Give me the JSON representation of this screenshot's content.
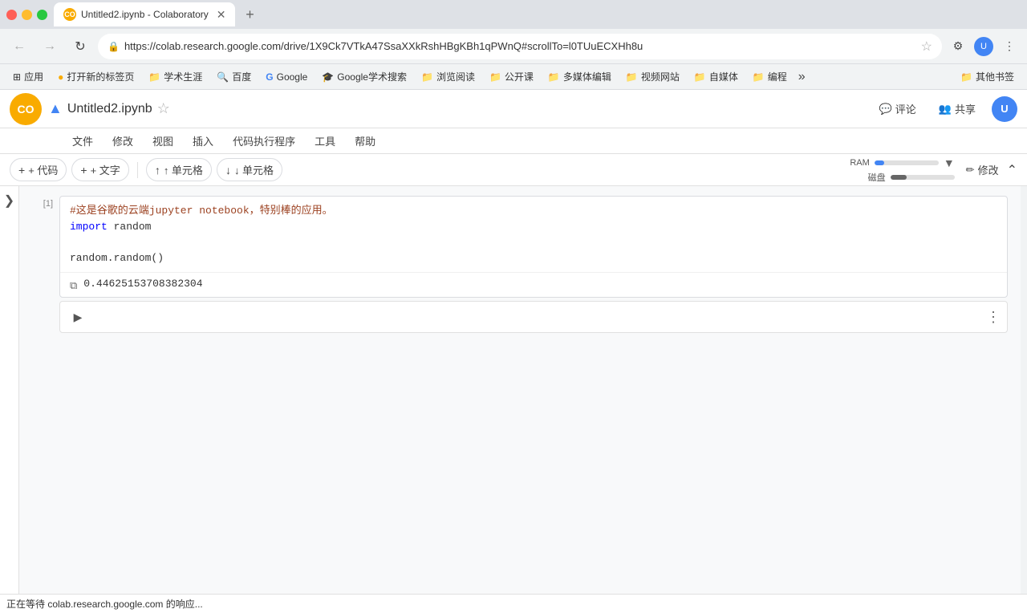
{
  "browser": {
    "tab": {
      "title": "Untitled2.ipynb - Colaboratory",
      "favicon_text": "CO"
    },
    "new_tab_label": "+",
    "nav": {
      "back_title": "后退",
      "forward_title": "前进",
      "refresh_title": "刷新",
      "url": "https://colab.research.google.com/drive/1X9Ck7VTkA47SsaXXkRshHBgKBh1qPWnQ#scrollTo=l0TUuECXHh8u",
      "lock_icon": "🔒",
      "star_icon": "☆"
    },
    "bookmarks": [
      {
        "icon": "⊞",
        "label": "应用"
      },
      {
        "icon": "🔶",
        "label": "打开新的标签页"
      },
      {
        "icon": "📁",
        "label": "学术生涯"
      },
      {
        "icon": "🔍",
        "label": "百度"
      },
      {
        "icon": "G",
        "label": "Google"
      },
      {
        "icon": "🎓",
        "label": "Google学术搜索"
      },
      {
        "icon": "📁",
        "label": "浏览阅读"
      },
      {
        "icon": "📁",
        "label": "公开课"
      },
      {
        "icon": "📁",
        "label": "多媒体编辑"
      },
      {
        "icon": "📁",
        "label": "视频网站"
      },
      {
        "icon": "📁",
        "label": "自媒体"
      },
      {
        "icon": "📁",
        "label": "编程"
      }
    ],
    "bookmarks_more": "»",
    "other_bookmarks": "其他书签"
  },
  "colab": {
    "logo_text": "CO",
    "drive_icon": "▲",
    "file_name": "Untitled2.ipynb",
    "star_icon": "☆",
    "menu_items": [
      "文件",
      "修改",
      "视图",
      "插入",
      "代码执行程序",
      "工具",
      "帮助"
    ],
    "toolbar": {
      "add_code": "+ 代码",
      "add_text": "+ 文字",
      "move_up": "↑ 单元格",
      "move_down": "↓ 单元格"
    },
    "ram_label": "RAM",
    "disk_label": "磁盘",
    "ram_percent": 15,
    "disk_percent": 25,
    "edit_label": "修改",
    "comment_label": "评论",
    "share_label": "共享",
    "left_toggle_icon": "❯",
    "cell": {
      "number": "[1]",
      "code_line1": "#这是谷歌的云端jupyter notebook，特别棒的应用。",
      "code_line2": "import random",
      "code_line3": "",
      "code_line4": "random.random()",
      "output_value": "0.44625153708382304"
    },
    "empty_cell_run_icon": "▶",
    "empty_cell_menu_icon": "⋮"
  },
  "status_bar": {
    "text": "正在等待 colab.research.google.com 的响应..."
  }
}
